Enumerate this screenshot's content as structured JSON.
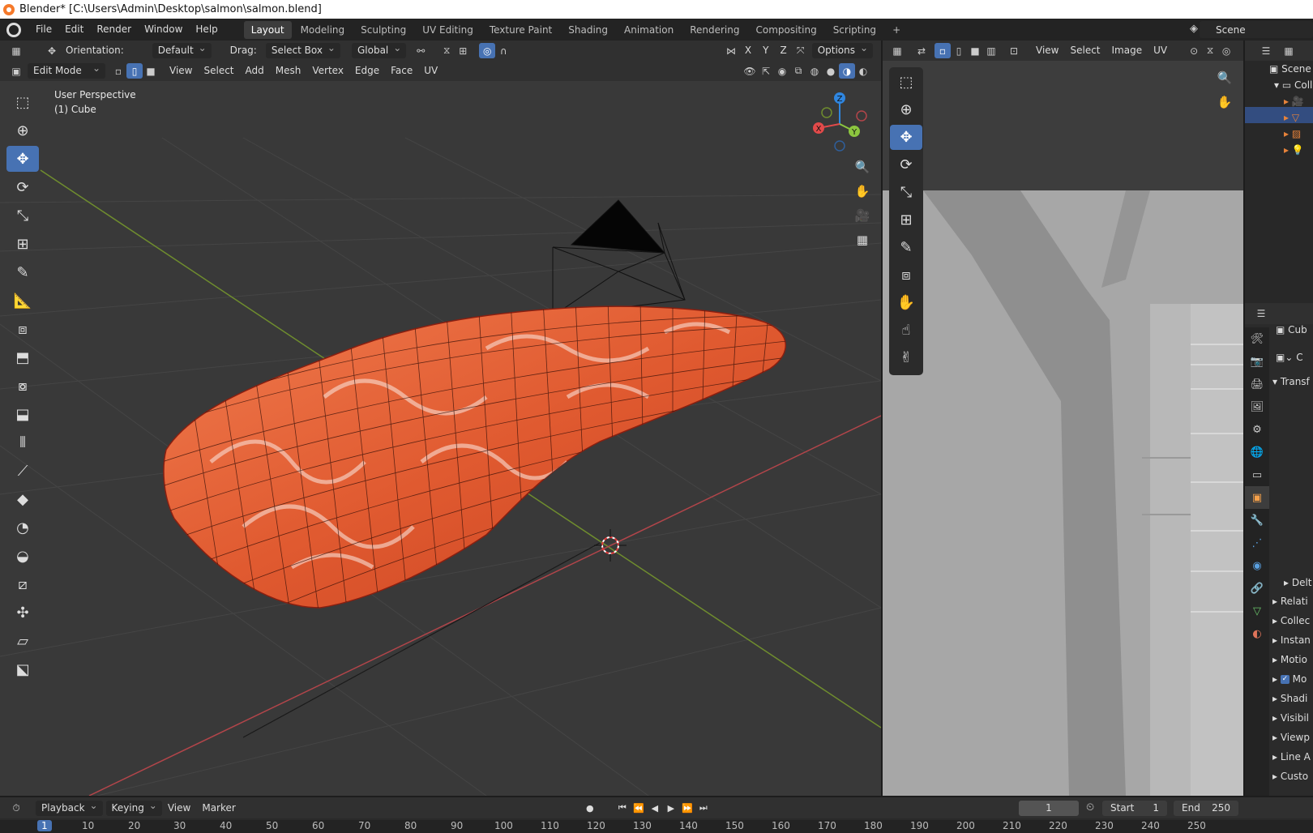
{
  "window": {
    "title": "Blender* [C:\\Users\\Admin\\Desktop\\salmon\\salmon.blend]"
  },
  "menu": [
    "File",
    "Edit",
    "Render",
    "Window",
    "Help"
  ],
  "workspaces": [
    "Layout",
    "Modeling",
    "Sculpting",
    "UV Editing",
    "Texture Paint",
    "Shading",
    "Animation",
    "Rendering",
    "Compositing",
    "Scripting"
  ],
  "active_workspace": "Layout",
  "scene_name": "Scene",
  "viewport": {
    "tool_header": {
      "orientation_label": "Orientation:",
      "orientation_value": "Default",
      "drag_label": "Drag:",
      "drag_value": "Select Box",
      "transform_space": "Global",
      "axes": [
        "X",
        "Y",
        "Z"
      ],
      "options": "Options"
    },
    "mode": "Edit Mode",
    "menus": [
      "View",
      "Select",
      "Add",
      "Mesh",
      "Vertex",
      "Edge",
      "Face",
      "UV"
    ],
    "info_line1": "User Perspective",
    "info_line2": "(1) Cube",
    "gizmo_axes": [
      "X",
      "Y",
      "Z"
    ]
  },
  "uv_editor": {
    "menus": [
      "View",
      "Select",
      "Image",
      "UV"
    ]
  },
  "outliner": {
    "items": [
      "Scene C",
      "Coll"
    ]
  },
  "properties": {
    "object_name": "Cub",
    "data_field": "C",
    "section": "Transf",
    "subsection": "Delt",
    "panels": [
      "Relati",
      "Collec",
      "Instan",
      "Motio",
      "Mo",
      "Shadi",
      "Visibil",
      "Viewp",
      "Line A",
      "Custo"
    ]
  },
  "timeline": {
    "menus": [
      "Playback",
      "Keying",
      "View",
      "Marker"
    ],
    "current_frame": "1",
    "start_label": "Start",
    "start_value": "1",
    "end_label": "End",
    "end_value": "250",
    "ruler": [
      "1",
      "10",
      "20",
      "30",
      "40",
      "50",
      "60",
      "70",
      "80",
      "90",
      "100",
      "110",
      "120",
      "130",
      "140",
      "150",
      "160",
      "170",
      "180",
      "190",
      "200",
      "210",
      "220",
      "230",
      "240",
      "250"
    ]
  },
  "colors": {
    "accent": "#4772b3",
    "axis_x": "#e24a4a",
    "axis_y": "#8cc63f",
    "axis_z": "#2f86e0",
    "salmon": "#e8623a"
  }
}
